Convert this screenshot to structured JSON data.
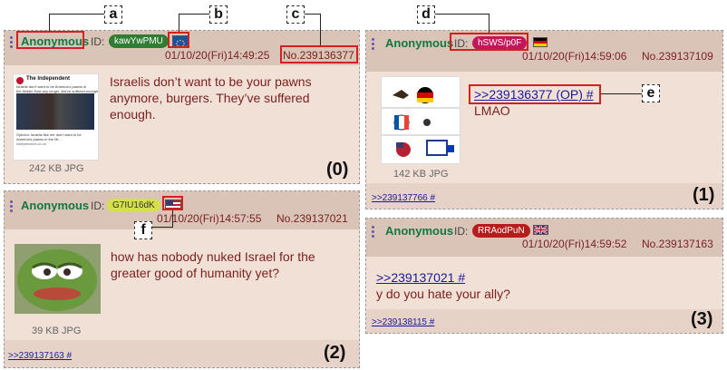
{
  "posts": [
    {
      "name": "Anonymous",
      "id_label": "ID:",
      "id_value": "kawYwPMU",
      "id_color": "#2e7d32",
      "flag": "eu-flag",
      "datetime": "01/10/20(Fri)14:49:25",
      "number": "No.239136377",
      "text": "Israelis don’t want to be your pawns anymore, burgers. They’ve suffered enough.",
      "file_info": "242 KB JPG",
      "panel": "(0)"
    },
    {
      "name": "Anonymous",
      "id_label": "ID:",
      "id_value": "hSWS/p0F",
      "id_color": "#c2185b",
      "flag": "germany-flag",
      "datetime": "01/10/20(Fri)14:59:06",
      "number": "No.239137109",
      "quote": ">>239136377 (OP) #",
      "text": "LMAO",
      "file_info": "142 KB JPG",
      "reply": ">>239137766 #",
      "panel": "(1)"
    },
    {
      "name": "Anonymous",
      "id_label": "ID:",
      "id_value": "G7IU16dK",
      "id_color": "#cddc39",
      "flag": "usa-flag",
      "datetime": "01/10/20(Fri)14:57:55",
      "number": "No.239137021",
      "text": "how has nobody nuked Israel for the greater good of humanity yet?",
      "file_info": "39 KB JPG",
      "reply": ">>239137163 #",
      "panel": "(2)"
    },
    {
      "name": "Anonymous",
      "id_label": "ID:",
      "id_value": "RRAodPuN",
      "id_color": "#b71c1c",
      "flag": "uk-flag",
      "datetime": "01/10/20(Fri)14:59:52",
      "number": "No.239137163",
      "quote": ">>239137021 #",
      "text": "y do you hate your ally?",
      "reply": ">>239138115 #",
      "panel": "(3)"
    }
  ],
  "annotations": [
    "a",
    "b",
    "c",
    "d",
    "e",
    "f"
  ],
  "tweet_thumb": {
    "account": "The Independent",
    "lines": [
      "Israelis don't want to be America's pawns in",
      "the Middle East any longer. We've suffered enough",
      "Opinion: Israelis like me don't want to be",
      "America's pawns in the Mi...",
      "independent.co.uk"
    ]
  }
}
